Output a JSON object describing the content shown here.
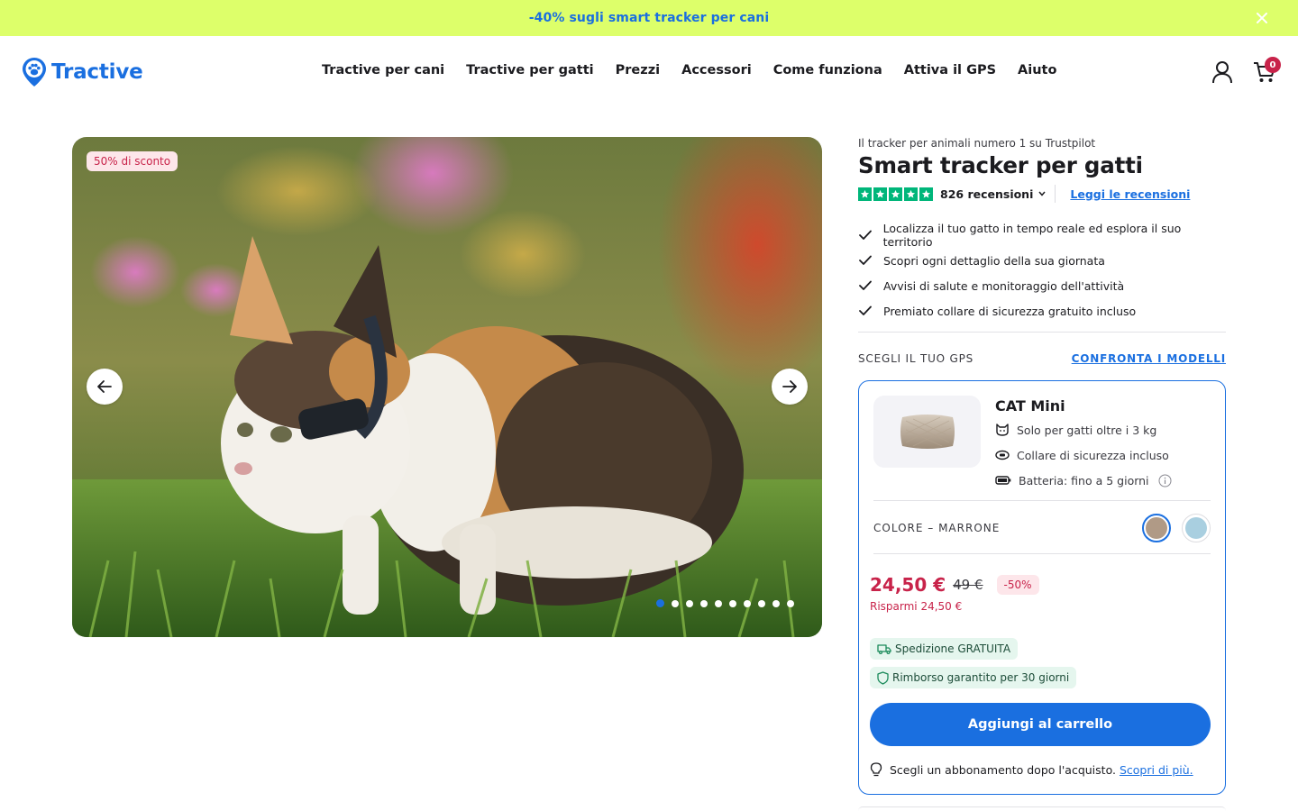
{
  "promo": {
    "text": "-40% sugli smart tracker per cani",
    "close_icon": "close-icon"
  },
  "header": {
    "logo_text": "Tractive",
    "nav": [
      "Tractive per cani",
      "Tractive per gatti",
      "Prezzi",
      "Accessori",
      "Come funziona",
      "Attiva il GPS",
      "Aiuto"
    ],
    "cart_count": "0"
  },
  "gallery": {
    "discount_tag": "50% di sconto",
    "slide_count": 10,
    "active_slide": 1
  },
  "product": {
    "kicker": "Il tracker per animali numero 1 su Trustpilot",
    "title": "Smart tracker per gatti",
    "rating_stars": 5,
    "reviews_count": "826 recensioni",
    "reviews_link": "Leggi le recensioni",
    "features": [
      "Localizza il tuo gatto in tempo reale ed esplora il suo territorio",
      "Scopri ogni dettaglio della sua giornata",
      "Avvisi di salute e monitoraggio dell'attività",
      "Premiato collare di sicurezza gratuito incluso"
    ],
    "choose_label": "SCEGLI IL TUO GPS",
    "compare_link": "CONFRONTA I MODELLI"
  },
  "card": {
    "name": "CAT Mini",
    "specs": [
      "Solo per gatti oltre i 3 kg",
      "Collare di sicurezza incluso",
      "Batteria: fino a 5 giorni"
    ],
    "color_label": "COLORE – MARRONE",
    "swatches": [
      {
        "name": "Marrone",
        "color": "#b09a86",
        "selected": true
      },
      {
        "name": "Azzurro",
        "color": "#a9cfe0",
        "selected": false
      }
    ],
    "price": "24,50 €",
    "old_price": "49 €",
    "discount_badge": "-50%",
    "savings": "Risparmi 24,50 €",
    "shipping": "Spedizione GRATUITA",
    "refund": "Rimborso garantito per 30 giorni",
    "cta": "Aggiungi al carrello",
    "sub_note": "Scegli un abbonamento dopo l'acquisto.",
    "sub_link": "Scopri di più."
  },
  "colors": {
    "brand_blue": "#1a6fe0",
    "promo_bg": "#ddff6a",
    "sale_red": "#c8234a",
    "trustpilot_green": "#00b67a"
  }
}
